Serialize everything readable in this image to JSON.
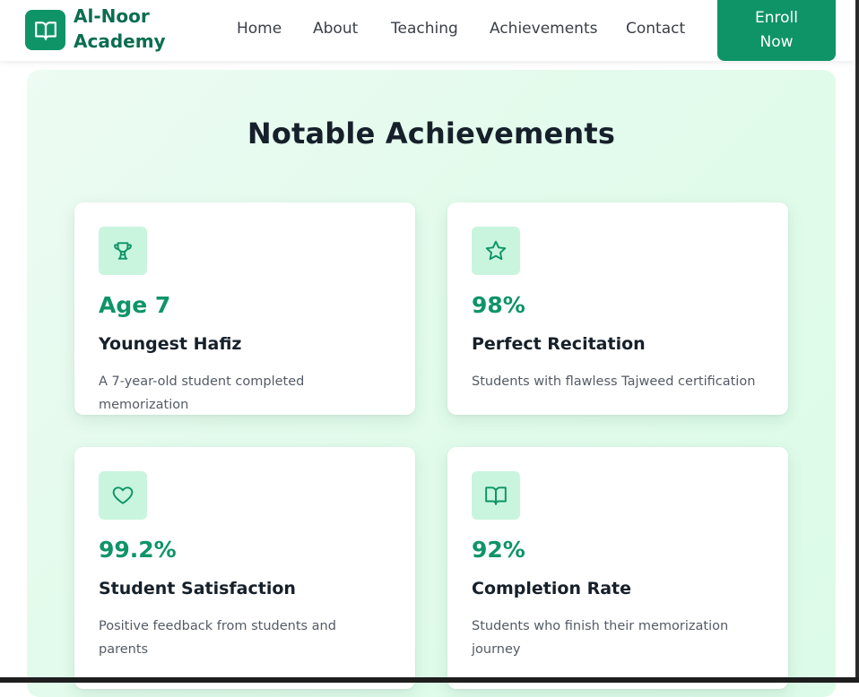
{
  "header": {
    "brand": "Al-Noor Academy",
    "nav": [
      "Home",
      "About",
      "Teaching",
      "Achievements",
      "Contact"
    ],
    "cta": "Enroll Now"
  },
  "section": {
    "title": "Notable Achievements",
    "cards": [
      {
        "icon": "trophy-icon",
        "value": "Age 7",
        "title": "Youngest Hafiz",
        "desc": "A 7-year-old student completed memorization"
      },
      {
        "icon": "star-icon",
        "value": "98%",
        "title": "Perfect Recitation",
        "desc": "Students with flawless Tajweed certification"
      },
      {
        "icon": "heart-icon",
        "value": "99.2%",
        "title": "Student Satisfaction",
        "desc": "Positive feedback from students and parents"
      },
      {
        "icon": "book-icon",
        "value": "92%",
        "title": "Completion Rate",
        "desc": "Students who finish their memorization journey"
      }
    ]
  },
  "colors": {
    "accent": "#0e9467",
    "accent_light": "#c9f5de",
    "section_bg": "#e3fbec",
    "heading": "#16202a"
  }
}
